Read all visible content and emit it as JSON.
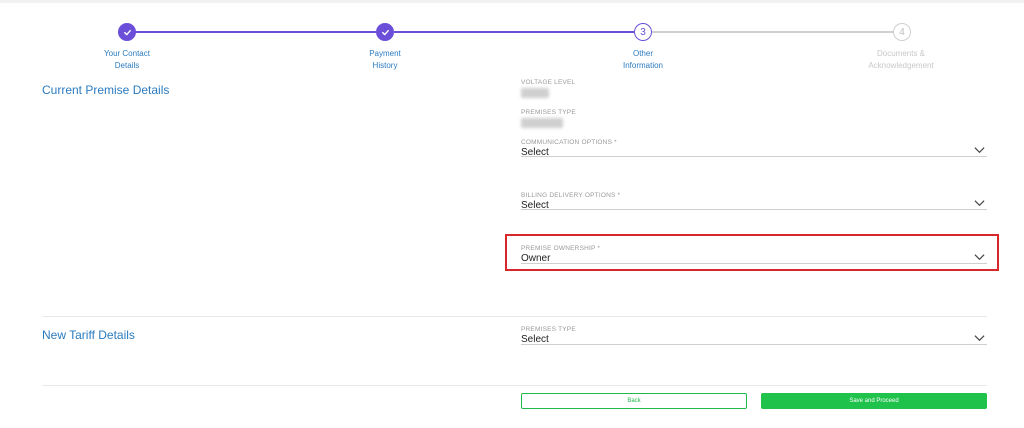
{
  "stepper": {
    "steps": [
      {
        "label_line1": "Your Contact",
        "label_line2": "Details",
        "status": "done",
        "number": "1"
      },
      {
        "label_line1": "Payment",
        "label_line2": "History",
        "status": "done",
        "number": "2"
      },
      {
        "label_line1": "Other",
        "label_line2": "Information",
        "status": "active",
        "number": "3"
      },
      {
        "label_line1": "Documents &",
        "label_line2": "Acknowledgement",
        "status": "todo",
        "number": "4"
      }
    ]
  },
  "current_premise": {
    "title": "Current Premise Details",
    "voltage_level_label": "VOLTAGE LEVEL",
    "premises_type_label": "PREMISES TYPE",
    "communication": {
      "label": "COMMUNICATION OPTIONS *",
      "value": "Select"
    },
    "billing": {
      "label": "BILLING DELIVERY OPTIONS *",
      "value": "Select"
    },
    "ownership": {
      "label": "PREMISE OWNERSHIP *",
      "value": "Owner"
    }
  },
  "new_tariff": {
    "title": "New Tariff Details",
    "premises_type": {
      "label": "PREMISES TYPE",
      "value": "Select"
    }
  },
  "actions": {
    "back_label": "Back",
    "save_label": "Save and Proceed"
  },
  "colors": {
    "accent": "#6b4fd8",
    "link": "#2b7bbf",
    "success": "#1fc24b",
    "highlight": "#d8262b"
  }
}
